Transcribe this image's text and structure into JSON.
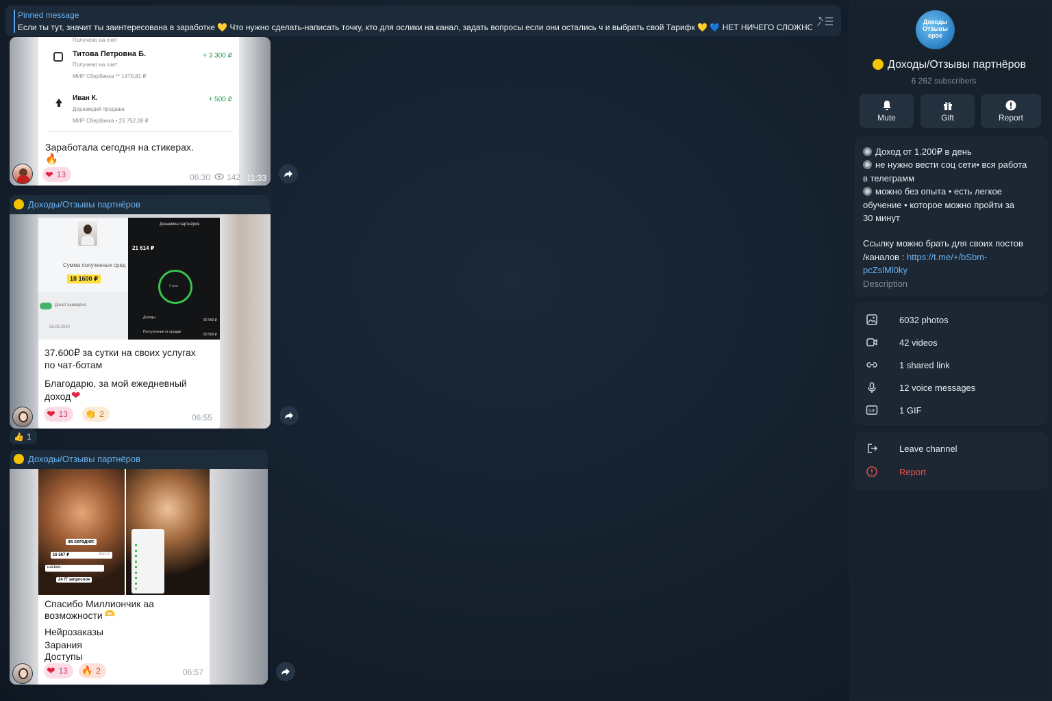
{
  "pinned": {
    "title": "Pinned message",
    "text": "Если ты тут, значит ты заинтересована в заработке 💛  Что нужно сделать-написать точку, кто для ослики на канал, задать вопросы если они остались ч и выбрать свой Тарифк 💛  💙 НЕТ НИЧЕГО СЛОЖНОГО ..."
  },
  "channel": {
    "name": "Доходы/Отзывы партнёров",
    "subscribers": "6 262 subscribers",
    "avatar_text": [
      "Доходы",
      "Отзывы",
      "ерое"
    ]
  },
  "actions": {
    "mute": "Mute",
    "gift": "Gift",
    "report": "Report"
  },
  "description": {
    "line1": "Доход от 1.200₽ в день",
    "line2a": "не нужно вести соц сети• вся работа",
    "line2b": "в телеграмм",
    "line3a": "можно без опыта • есть легкое",
    "line3b": "обучение • которое можно пройти за",
    "line3c": "30 минут",
    "line4a": "Ссылку можно брать для своих постов",
    "line4b": "/каналов : ",
    "link1": "https://t.me/+/bSbm-",
    "link2": "pcZslMl0ky",
    "label": "Description"
  },
  "media": {
    "photos": "6032 photos",
    "videos": "42 videos",
    "links": "1 shared link",
    "voice": "12 voice messages",
    "gif": "1 GIF"
  },
  "danger": {
    "leave": "Leave channel",
    "report": "Report"
  },
  "msg1": {
    "received_top": "Получено на счет",
    "row1_name": "Титова Петровна Б.",
    "row1_amount": "+ 3 300 ₽",
    "row1_sub": "Получено на счет",
    "row1_card": "МИР Сбербанка ** 1470,81 ₽",
    "row2_name": "Иван К.",
    "row2_amount": "+ 500 ₽",
    "row2_sub": "Доразмдий продажа",
    "row2_card": "МИР Сбербанка • 23 752,08 ₽",
    "caption": "Заработала сегодня на стикерах.",
    "emoji": "🔥",
    "react_count": "13",
    "time": "06:30",
    "views": "142",
    "time2": "11:33"
  },
  "msg2": {
    "sender": "Доходы/Отзывы партнёров",
    "shot_left_label": "Сумма полученных сред",
    "shot_left_amount": "18 1600 ₽",
    "shot_left_toggle": "Донат выведено",
    "shot_left_date": "26.03.2024",
    "shot_right_title": "Динамика партнёров",
    "shot_right_amount": "21 614 ₽",
    "shot_right_ring": "2 млн",
    "shot_right_row1": "Доходы",
    "shot_right_row1_val": "82 560 ₽",
    "shot_right_row2": "Поступление от продаж",
    "shot_right_row2_val": "83 569 ₽",
    "caption_line1": "37.600₽ за сутки на своих услугах",
    "caption_line2": "по чат-ботам",
    "caption_line3": "Благодарю, за мой ежедневный",
    "caption_line4": "доход",
    "react1": "13",
    "react2": "2",
    "time": "06:55",
    "thumb_count": "1"
  },
  "msg3": {
    "sender": "Доходы/Отзывы партнёров",
    "label_today": "за сегодня:",
    "label_amount": "16 567 ₽",
    "label_amount_right": "8163 ₽",
    "label_earned": "насвои:",
    "label_requests": "24 IT запросоое",
    "caption_line1": "Спасибо Миллиончик аа",
    "caption_line2": "возможности",
    "caption_line3": "Нейрозаказы",
    "caption_line4": "Зарания",
    "caption_line5": "Доступы",
    "react1": "13",
    "react2": "2",
    "time": "06:57"
  }
}
